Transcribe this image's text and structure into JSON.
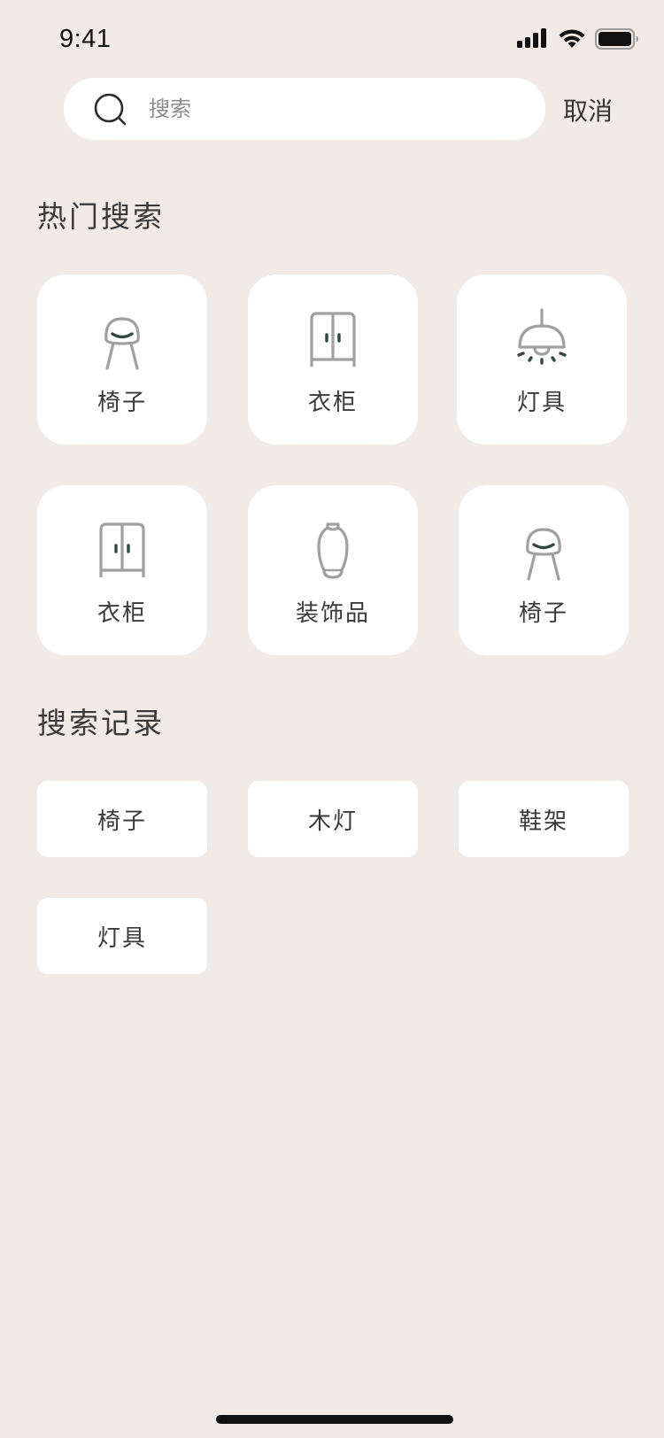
{
  "status_bar": {
    "time": "9:41"
  },
  "search": {
    "placeholder": "搜索",
    "value": "",
    "cancel_label": "取消"
  },
  "hot_search": {
    "title": "热门搜索",
    "items": [
      {
        "label": "椅子",
        "icon": "chair-icon"
      },
      {
        "label": "衣柜",
        "icon": "wardrobe-icon"
      },
      {
        "label": "灯具",
        "icon": "lamp-icon"
      },
      {
        "label": "衣柜",
        "icon": "wardrobe-icon"
      },
      {
        "label": "装饰品",
        "icon": "vase-icon"
      },
      {
        "label": "椅子",
        "icon": "chair-icon"
      }
    ]
  },
  "search_history": {
    "title": "搜索记录",
    "items": [
      "椅子",
      "木灯",
      "鞋架",
      "灯具"
    ]
  },
  "colors": {
    "background": "#F0EBE7",
    "card": "#FFFFFF",
    "icon_stroke": "#A0A0A0",
    "icon_accent": "#2F4A3F",
    "text": "#3A3A3A"
  }
}
